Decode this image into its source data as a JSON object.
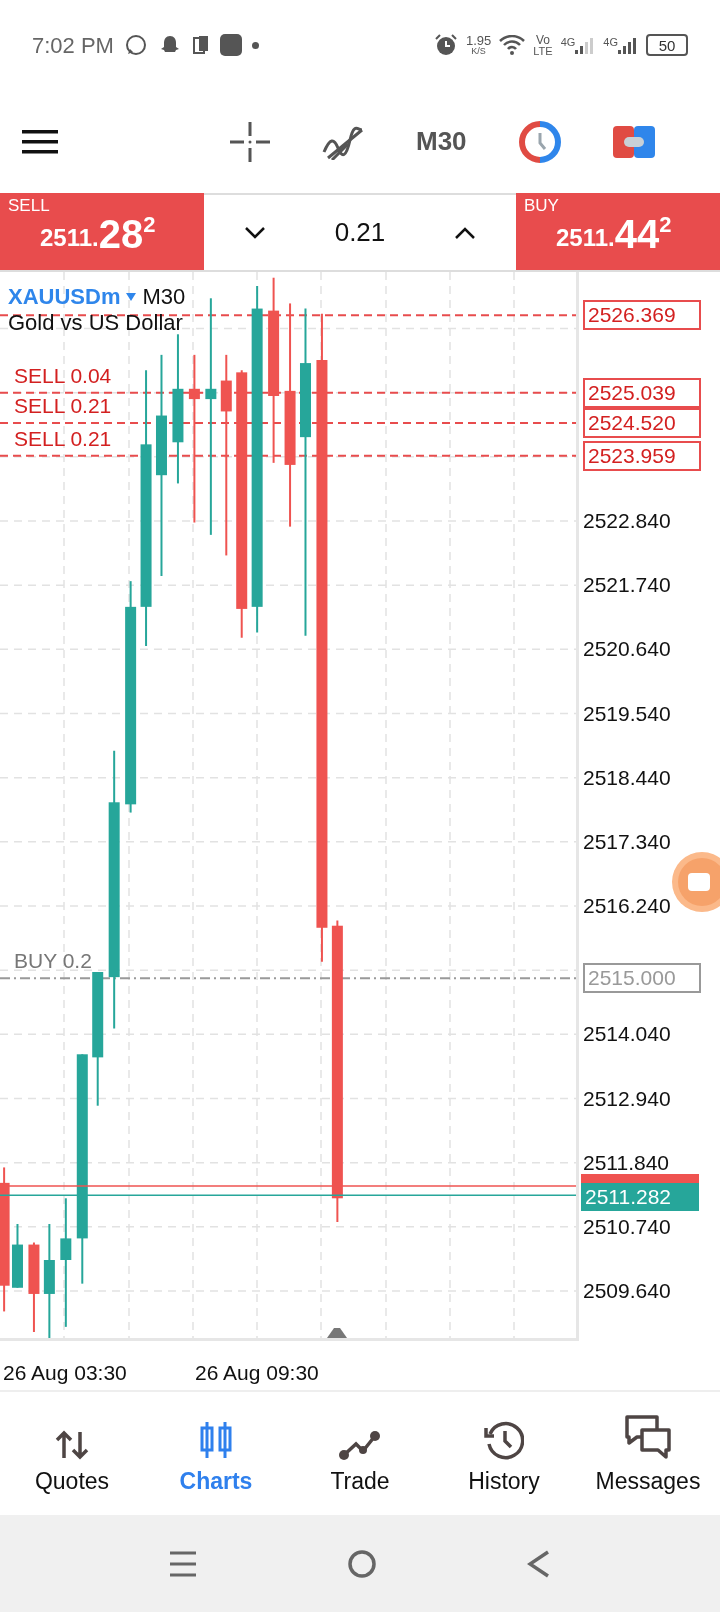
{
  "status_bar": {
    "time": "7:02 PM",
    "net_speed": "1.95",
    "net_unit": "K/S",
    "volte_top": "Vo",
    "volte_bottom": "LTE",
    "sim_1": "4G",
    "sim_2": "4G",
    "battery": "50"
  },
  "toolbar": {
    "timeframe": "M30"
  },
  "trade_bar": {
    "sell": {
      "label": "SELL",
      "price_main": "2511.",
      "price_big": "28",
      "price_sup": "2"
    },
    "volume": "0.21",
    "buy": {
      "label": "BUY",
      "price_main": "2511.",
      "price_big": "44",
      "price_sup": "2"
    }
  },
  "chart": {
    "symbol": "XAUUSDm",
    "timeframe": "M30",
    "description": "Gold vs US Dollar",
    "price_scale": [
      "2522.840",
      "2521.740",
      "2520.640",
      "2519.540",
      "2518.440",
      "2517.340",
      "2516.240",
      "2514.040",
      "2512.940",
      "2511.840",
      "2510.740",
      "2509.640"
    ],
    "order_lines": [
      {
        "kind": "sell",
        "price": "2526.369"
      },
      {
        "kind": "sell",
        "label": "SELL 0.04",
        "price": "2525.039"
      },
      {
        "kind": "sell",
        "label": "SELL 0.21",
        "price": "2524.520"
      },
      {
        "kind": "sell",
        "label": "SELL 0.21",
        "price": "2523.959"
      },
      {
        "kind": "buy",
        "label": "BUY 0.2",
        "price": "2515.000"
      }
    ],
    "bid_price": "2511.282",
    "time_labels": [
      "26 Aug 03:30",
      "26 Aug 09:30"
    ]
  },
  "nav_tabs": [
    {
      "label": "Quotes",
      "selected": false
    },
    {
      "label": "Charts",
      "selected": true
    },
    {
      "label": "Trade",
      "selected": false
    },
    {
      "label": "History",
      "selected": false
    },
    {
      "label": "Messages",
      "selected": false
    }
  ]
}
